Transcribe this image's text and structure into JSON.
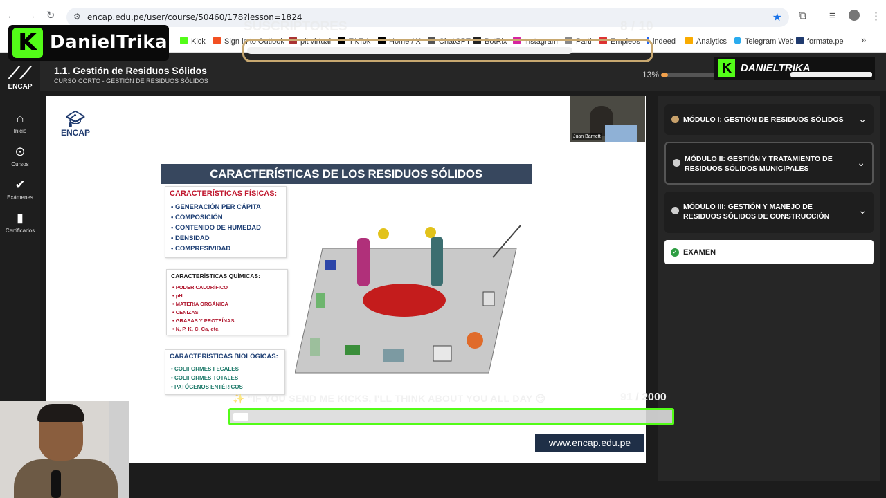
{
  "browser": {
    "url": "encap.edu.pe/user/course/50460/178?lesson=1824",
    "bookmarks": [
      "Kick",
      "Sign in to Outlook",
      "pit virtual",
      "TikTok",
      "Home / X",
      "ChatGPT",
      "BotRix",
      "Instagram",
      "Parti",
      "Empleos",
      "indeed",
      "Analytics",
      "Telegram Web",
      "formate.pe"
    ]
  },
  "stream_overlay": {
    "channel_name": "DanielTrika",
    "channel_name_2": "DANIELTRIKA",
    "sub_goal_label": "SUSCRIPTORES",
    "sub_goal_count": "8 / 10",
    "kicks_message": "\"IF YOU SEND ME KICKS, I'LL THINK ABOUT YOU ALL DAY",
    "kicks_current": "91",
    "kicks_target": "/ 2000",
    "kicks_progress": 0.0455
  },
  "app": {
    "logo_text": "ENCAP",
    "course_title": "1.1. Gestión de Residuos Sólidos",
    "course_subtitle": "CURSO CORTO - GESTIÓN DE RESIDUOS SÓLIDOS",
    "progress_label": "13%",
    "progress_value": 0.13,
    "nav": [
      {
        "label": "Inicio",
        "icon": "home-icon"
      },
      {
        "label": "Cursos",
        "icon": "play-circle-icon"
      },
      {
        "label": "Exámenes",
        "icon": "check-icon"
      },
      {
        "label": "Certificados",
        "icon": "bookmark-icon"
      }
    ]
  },
  "slide": {
    "logo_text": "ENCAP",
    "presenter_name": "Juan Barnett",
    "title": "CARACTERÍSTICAS DE LOS RESIDUOS SÓLIDOS",
    "physical": {
      "heading": "CARACTERÍSTICAS FÍSICAS:",
      "items": [
        "GENERACIÓN PER CÁPITA",
        "COMPOSICIÓN",
        "CONTENIDO DE HUMEDAD",
        "DENSIDAD",
        "COMPRESIVIDAD"
      ]
    },
    "chemical": {
      "heading": "CARACTERÍSTICAS QUÍMICAS:",
      "items": [
        "PODER CALORÍFICO",
        "pH",
        "MATERIA ORGÁNICA",
        "CENIZAS",
        "GRASAS Y PROTEÍNAS",
        "N, P, K, C, Ca, etc."
      ]
    },
    "biological": {
      "heading": "CARACTERÍSTICAS BIOLÓGICAS:",
      "items": [
        "COLIFORMES FECALES",
        "COLIFORMES TOTALES",
        "PATÓGENOS ENTÉRICOS"
      ]
    },
    "website": "www.encap.edu.pe"
  },
  "modules": [
    {
      "title": "MÓDULO I: GESTIÓN DE RESIDUOS SÓLIDOS",
      "status": "completed"
    },
    {
      "title": "MÓDULO II: GESTIÓN Y TRATAMIENTO DE RESIDUOS SÓLIDOS MUNICIPALES",
      "status": "active"
    },
    {
      "title": "MÓDULO III: GESTIÓN Y MANEJO DE RESIDUOS SÓLIDOS DE CONSTRUCCIÓN",
      "status": "pending"
    }
  ],
  "exam": {
    "label": "EXAMEN"
  },
  "colors": {
    "kick_green": "#53fc18",
    "progress_orange": "#f2a04b",
    "slide_title_bg": "#37475e"
  }
}
